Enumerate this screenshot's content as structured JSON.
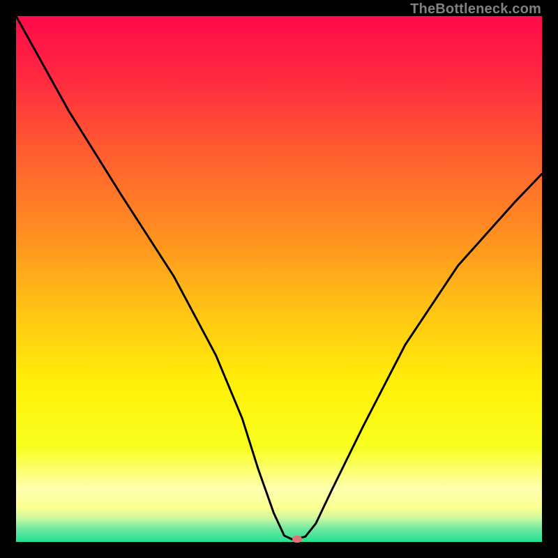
{
  "watermark": "TheBottleneck.com",
  "gradient_stops": [
    {
      "offset": 0.0,
      "color": "#ff0a4a"
    },
    {
      "offset": 0.12,
      "color": "#ff2a3f"
    },
    {
      "offset": 0.25,
      "color": "#ff5a30"
    },
    {
      "offset": 0.4,
      "color": "#ff8a22"
    },
    {
      "offset": 0.55,
      "color": "#ffc015"
    },
    {
      "offset": 0.7,
      "color": "#fff007"
    },
    {
      "offset": 0.82,
      "color": "#f8ff20"
    },
    {
      "offset": 0.9,
      "color": "#ffffb0"
    },
    {
      "offset": 0.935,
      "color": "#fcff90"
    },
    {
      "offset": 0.955,
      "color": "#caf7a0"
    },
    {
      "offset": 0.975,
      "color": "#6fe8a0"
    },
    {
      "offset": 1.0,
      "color": "#22e090"
    }
  ],
  "chart_data": {
    "type": "line",
    "title": "",
    "xlabel": "",
    "ylabel": "",
    "xlim": [
      0,
      100
    ],
    "ylim": [
      0,
      100
    ],
    "series": [
      {
        "name": "bottleneck-curve",
        "x": [
          0,
          10,
          20,
          30,
          38,
          43,
          46,
          49,
          51,
          52.5,
          55,
          57,
          60,
          66,
          74,
          84,
          95,
          100
        ],
        "y": [
          100,
          82,
          66,
          50.5,
          35.5,
          23.5,
          14,
          5.5,
          1.2,
          0.5,
          1.0,
          3.5,
          9.8,
          22,
          37.5,
          52.5,
          64.8,
          70
        ]
      }
    ],
    "marker": {
      "x": 53.5,
      "y": 0.5,
      "color": "#e07078"
    }
  }
}
